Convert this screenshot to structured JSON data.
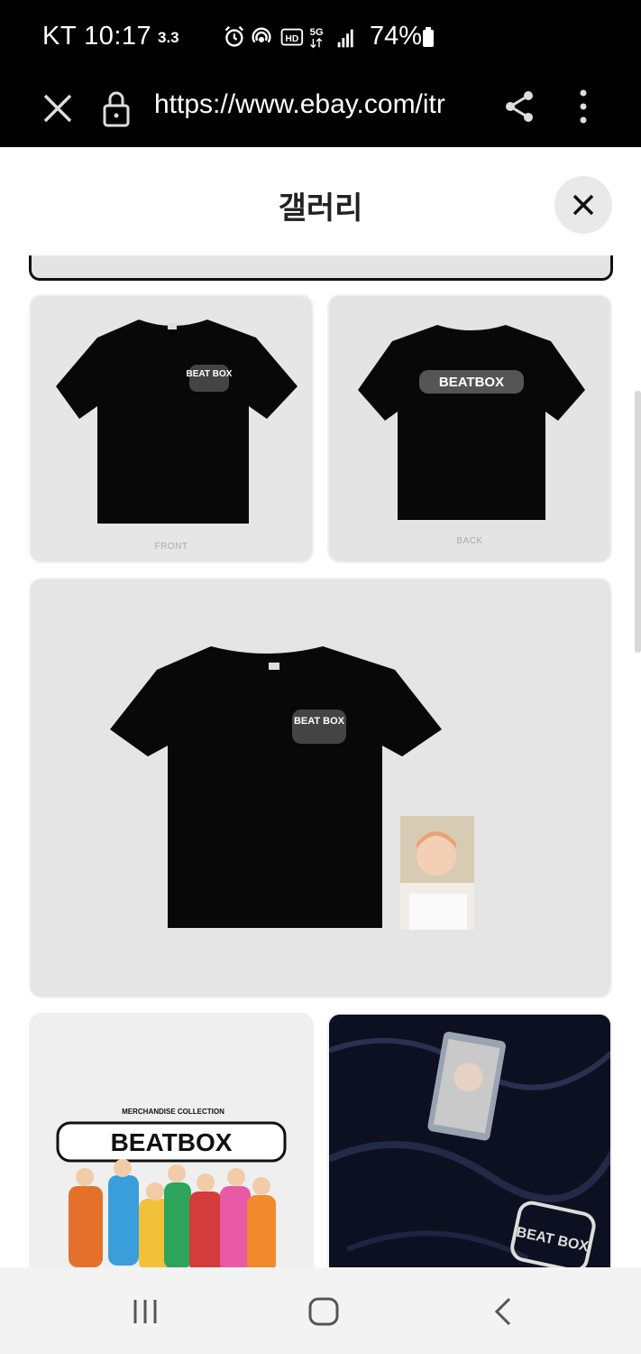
{
  "status_bar": {
    "carrier_time": "KT 10:17",
    "speed": "3.3",
    "battery": "74%",
    "icons": [
      "alarm-icon",
      "hotspot-icon",
      "hd-icon",
      "5g-icon",
      "signal-icon",
      "battery-icon"
    ],
    "badge_hd": "HD",
    "badge_5g": "5G"
  },
  "url_bar": {
    "url": "https://www.ebay.com/itr",
    "icons": [
      "close-icon",
      "lock-icon",
      "share-icon",
      "more-icon"
    ]
  },
  "gallery": {
    "title": "갤러리",
    "close_icon": "close-icon",
    "images": [
      {
        "caption": "FRONT",
        "logo": "BEAT BOX"
      },
      {
        "caption": "BACK",
        "logo": "BEATBOX"
      },
      {
        "caption": "",
        "logo": "BEAT BOX"
      },
      {
        "caption": "",
        "header": "MERCHANDISE COLLECTION",
        "logo": "BEATBOX"
      },
      {
        "caption": "",
        "logo": "BEAT BOX"
      }
    ]
  },
  "nav_bar": {
    "icons": [
      "recent-apps-icon",
      "home-icon",
      "back-icon"
    ]
  },
  "colors": {
    "status_bg": "#000000",
    "header_bg": "#ffffff",
    "thumb_bg": "#e6e6e6",
    "nav_bg": "#f3f3f3"
  }
}
